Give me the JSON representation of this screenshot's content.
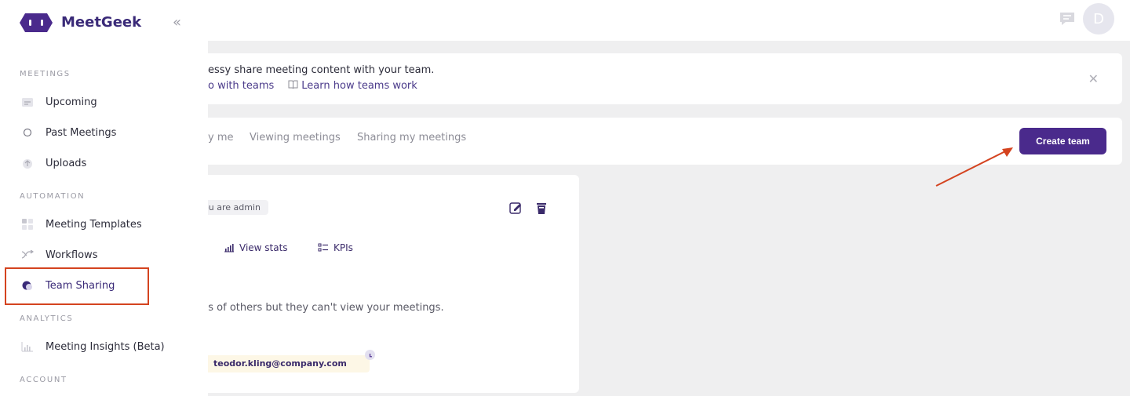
{
  "header": {
    "avatar_initial": "D",
    "icons": [
      "feedback-icon"
    ]
  },
  "banner": {
    "text": "essy share meeting content with your team.",
    "link_left": "o with teams",
    "link_right": "Learn how teams work",
    "close_icon": "close-icon"
  },
  "tabs": [
    {
      "label": "y me"
    },
    {
      "label": "Viewing meetings"
    },
    {
      "label": "Sharing my meetings"
    }
  ],
  "create_team_label": "Create team",
  "team_card": {
    "badge": "ou are admin",
    "actions": [
      {
        "label": "View stats",
        "icon": "bar-chart-icon"
      },
      {
        "label": "KPIs",
        "icon": "checklist-icon"
      }
    ],
    "description": "gs of others but they can't view your meetings.",
    "member_email": "teodor.kling@company.com"
  },
  "sidebar": {
    "brand": "MeetGeek",
    "sections": [
      {
        "title": "MEETINGS"
      },
      {
        "title": "AUTOMATION"
      },
      {
        "title": "ANALYTICS"
      },
      {
        "title": "ACCOUNT"
      }
    ],
    "items": [
      {
        "label": "Upcoming",
        "icon": "calendar-icon"
      },
      {
        "label": "Past Meetings",
        "icon": "circle-icon"
      },
      {
        "label": "Uploads",
        "icon": "upload-icon"
      },
      {
        "label": "Meeting Templates",
        "icon": "grid-icon"
      },
      {
        "label": "Workflows",
        "icon": "workflow-icon"
      },
      {
        "label": "Team Sharing",
        "icon": "team-icon"
      },
      {
        "label": "Meeting Insights (Beta)",
        "icon": "insights-icon"
      }
    ]
  },
  "colors": {
    "accent": "#4a2a8c",
    "annotation": "#d4431f"
  }
}
